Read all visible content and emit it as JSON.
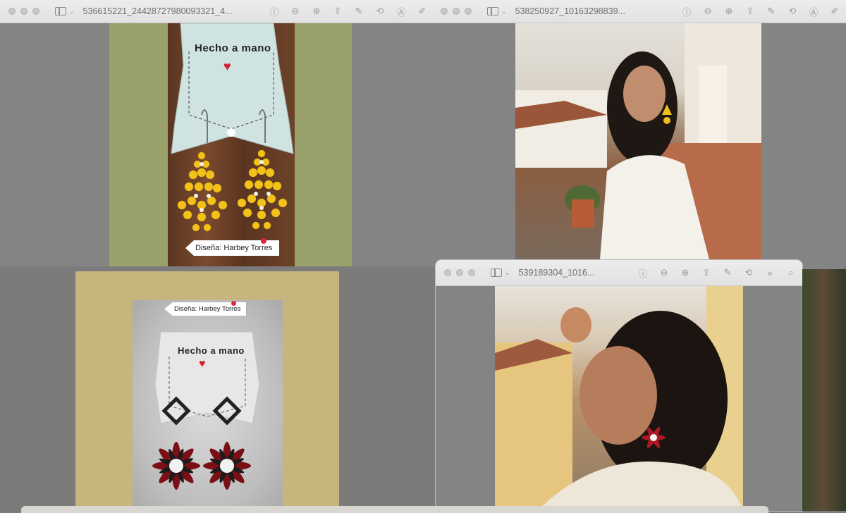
{
  "windows": {
    "top_left": {
      "title": "536615221_24428727980093321_4..."
    },
    "top_right": {
      "title": "538250927_10163298839..."
    },
    "bottom_right": {
      "title": "539189304_1016..."
    }
  },
  "photos": {
    "yellow_earrings": {
      "card_text": "Hecho a mano",
      "tag": "Diseña: Harbey Torres"
    },
    "red_earrings": {
      "card_text": "Hecho a mano",
      "tag": "Diseña: Harbey Torres"
    }
  },
  "icons": [
    "sidebar-icon",
    "info-icon",
    "zoom-out-icon",
    "zoom-in-icon",
    "share-icon",
    "markup-icon",
    "rotate-icon",
    "crop-icon",
    "more-icon",
    "search-icon"
  ],
  "colors": {
    "green_bg": "#9aa26a",
    "gold_bg": "#c7b77f",
    "titlebar": "#e8e8e8"
  }
}
